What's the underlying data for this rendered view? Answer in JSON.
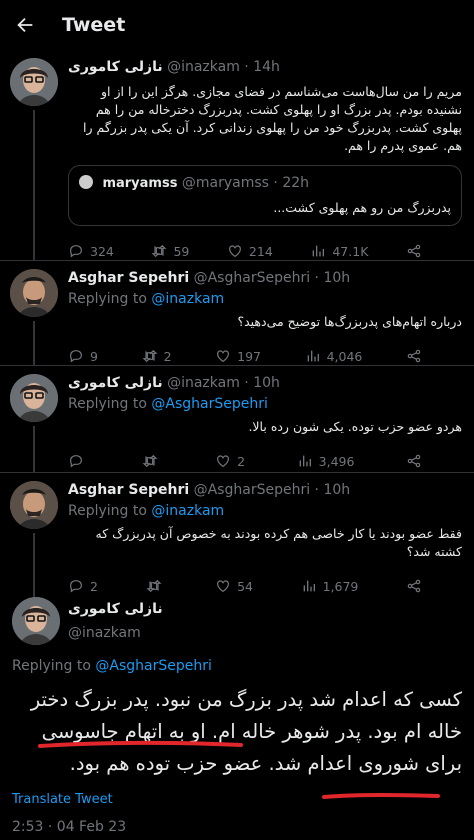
{
  "header": {
    "title": "Tweet"
  },
  "colors": {
    "link": "#1d9bf0",
    "muted": "#71767b",
    "underline": "#e1262c"
  },
  "tweets": [
    {
      "name": "نازلی کاموری",
      "handle": "@inazkam",
      "time": "14h",
      "body": "مریم را من سال‌هاست می‌شناسم در فضای مجازی. هرگز این را از او نشنیده بودم. پدر بزرگ او را پهلوی کشت. پدربزرگ دخترخاله من را هم پهلوی کشت. پدربزرگ خود من را پهلوی زندانی کرد. آن یکی پدر بزرگم را هم. عموی پدرم را هم.",
      "quote": {
        "name": "maryamss",
        "handle": "@maryamss",
        "time": "22h",
        "body": "پدربزرگ من رو هم پهلوی کشت..."
      },
      "stats": {
        "replies": "324",
        "retweets": "59",
        "likes": "214",
        "views": "47.1K"
      }
    },
    {
      "name": "Asghar Sepehri",
      "handle": "@AsgharSepehri",
      "time": "10h",
      "reply_prefix": "Replying to",
      "reply_to": "@inazkam",
      "body": "درباره اتهام‌های پدربزرگ‌ها توضیح می‌دهید؟",
      "stats": {
        "replies": "9",
        "retweets": "2",
        "likes": "197",
        "views": "4,046"
      }
    },
    {
      "name": "نازلی کاموری",
      "handle": "@inazkam",
      "time": "10h",
      "reply_prefix": "Replying to",
      "reply_to": "@AsgharSepehri",
      "body": "هردو عضو حزب توده. یکی شون رده بالا.",
      "stats": {
        "replies": "",
        "retweets": "",
        "likes": "2",
        "views": "3,496"
      }
    },
    {
      "name": "Asghar Sepehri",
      "handle": "@AsgharSepehri",
      "time": "10h",
      "reply_prefix": "Replying to",
      "reply_to": "@inazkam",
      "body": "فقط عضو بودند یا کار خاصی هم کرده بودند به خصوص آن پدربزرگ که کشته شد؟",
      "stats": {
        "replies": "2",
        "retweets": "",
        "likes": "54",
        "views": "1,679"
      }
    }
  ],
  "main": {
    "name": "نازلی کاموری",
    "handle": "@inazkam",
    "reply_prefix": "Replying to",
    "reply_to": "@AsgharSepehri",
    "body": "کسی که اعدام شد پدر بزرگ من نبود. پدر بزرگ دختر خاله ام بود. پدر شوهر خاله ام. او به اتهام جاسوسی برای شوروی اعدام شد. عضو حزب توده هم بود.",
    "translate": "Translate Tweet",
    "timestamp": "2:53 · 04 Feb 23"
  }
}
